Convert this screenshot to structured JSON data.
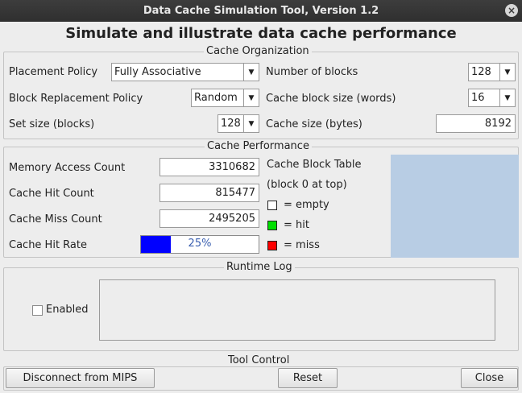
{
  "window": {
    "title": "Data Cache Simulation Tool, Version 1.2"
  },
  "heading": "Simulate and illustrate data cache performance",
  "cache_organization": {
    "title": "Cache Organization",
    "placement_policy_label": "Placement Policy",
    "placement_policy_value": "Fully Associative",
    "block_replacement_label": "Block Replacement Policy",
    "block_replacement_value": "Random",
    "set_size_label": "Set size (blocks)",
    "set_size_value": "128",
    "num_blocks_label": "Number of blocks",
    "num_blocks_value": "128",
    "block_size_label": "Cache block size (words)",
    "block_size_value": "16",
    "cache_size_label": "Cache size (bytes)",
    "cache_size_value": "8192"
  },
  "cache_performance": {
    "title": "Cache Performance",
    "access_count_label": "Memory Access Count",
    "access_count_value": "3310682",
    "hit_count_label": "Cache Hit Count",
    "hit_count_value": "815477",
    "miss_count_label": "Cache Miss Count",
    "miss_count_value": "2495205",
    "hit_rate_label": "Cache Hit Rate",
    "hit_rate_text": "25%",
    "hit_rate_fraction": 0.25,
    "block_table_title": "Cache Block Table",
    "block_table_subtitle": "(block 0 at top)",
    "legend": [
      {
        "label": "= empty",
        "color": "#ffffff"
      },
      {
        "label": "= hit",
        "color": "#00e000"
      },
      {
        "label": "= miss",
        "color": "#ff0000"
      }
    ],
    "block_table_color": "#b8cde4"
  },
  "runtime_log": {
    "title": "Runtime Log",
    "enabled_label": "Enabled",
    "enabled_checked": false
  },
  "tool_control": {
    "title": "Tool Control",
    "disconnect_label": "Disconnect from MIPS",
    "reset_label": "Reset",
    "close_label": "Close"
  },
  "icons": {
    "window_close": "close-icon",
    "combo_arrow": "chevron-down-icon"
  }
}
